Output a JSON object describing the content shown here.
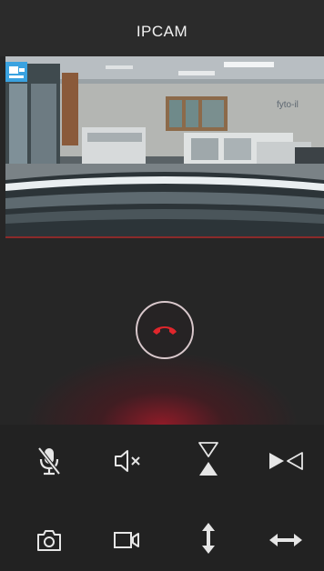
{
  "header": {
    "title": "IPCAM"
  },
  "colors": {
    "accent": "#e0262c",
    "hangup_ring": "#d9c8cc",
    "icon": "#e6e6e6"
  },
  "video": {
    "overlay_icon": "camera-badge-icon"
  },
  "call": {
    "hangup_icon": "phone-hangup-icon"
  },
  "controls": {
    "row1": [
      "mic-off-icon",
      "speaker-mute-icon",
      "flip-vertical-icon",
      "flip-horizontal-icon"
    ],
    "row2": [
      "snapshot-icon",
      "record-video-icon",
      "pan-vertical-icon",
      "pan-horizontal-icon"
    ]
  }
}
